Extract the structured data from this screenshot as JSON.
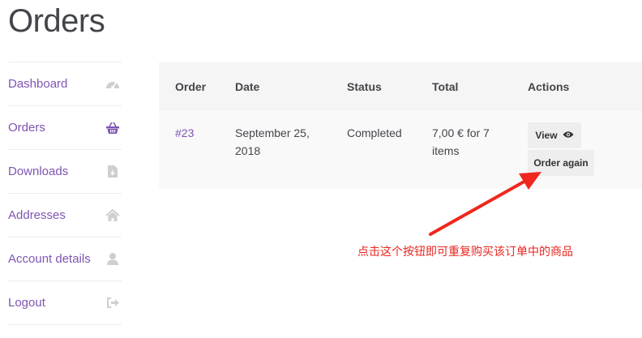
{
  "page": {
    "title": "Orders"
  },
  "sidebar": {
    "items": [
      {
        "label": "Dashboard",
        "icon": "dashboard-gauge-icon"
      },
      {
        "label": "Orders",
        "icon": "basket-icon",
        "active": true
      },
      {
        "label": "Downloads",
        "icon": "file-download-icon"
      },
      {
        "label": "Addresses",
        "icon": "home-icon"
      },
      {
        "label": "Account details",
        "icon": "user-icon"
      },
      {
        "label": "Logout",
        "icon": "sign-out-icon"
      }
    ]
  },
  "table": {
    "headers": {
      "order": "Order",
      "date": "Date",
      "status": "Status",
      "total": "Total",
      "actions": "Actions"
    },
    "rows": [
      {
        "order": "#23",
        "date": "September 25, 2018",
        "status": "Completed",
        "total": "7,00 € for 7 items",
        "view_label": "View",
        "again_label": "Order again"
      }
    ]
  },
  "annotation": {
    "text": "点击这个按钮即可重复购买该订单中的商品",
    "color": "#e8261f"
  },
  "colors": {
    "accent": "#7f54b3",
    "header_bg": "#f5f5f5",
    "row_bg": "#f9f9f9",
    "icon": "#c9c9c9"
  }
}
